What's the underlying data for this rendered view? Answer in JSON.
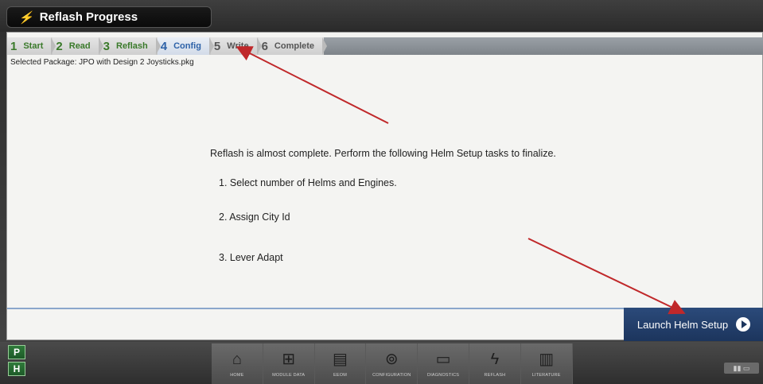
{
  "window": {
    "title": "Reflash Progress",
    "title_icon": "lightning-bolt-icon"
  },
  "steps": [
    {
      "num": "1",
      "label": "Start",
      "state": "done"
    },
    {
      "num": "2",
      "label": "Read",
      "state": "done"
    },
    {
      "num": "3",
      "label": "Reflash",
      "state": "done"
    },
    {
      "num": "4",
      "label": "Config",
      "state": "active"
    },
    {
      "num": "5",
      "label": "Write",
      "state": "todo"
    },
    {
      "num": "6",
      "label": "Complete",
      "state": "todo"
    }
  ],
  "selected_package": "Selected Package: JPO with Design 2 Joysticks.pkg",
  "message": "Reflash is almost complete. Perform the following Helm Setup tasks to finalize.",
  "tasks": [
    "1. Select number of Helms and Engines.",
    "2. Assign City Id",
    "3. Lever Adapt"
  ],
  "launch_button": {
    "label": "Launch Helm Setup"
  },
  "side_buttons": [
    "P",
    "H"
  ],
  "nav": [
    {
      "label": "HOME",
      "icon": "house-icon"
    },
    {
      "label": "MODULE DATA",
      "icon": "module-data-icon"
    },
    {
      "label": "EEOM",
      "icon": "eeom-icon"
    },
    {
      "label": "CONFIGURATION",
      "icon": "configuration-icon"
    },
    {
      "label": "DIAGNOSTICS",
      "icon": "diagnostics-icon"
    },
    {
      "label": "REFLASH",
      "icon": "lightning-bolt-icon"
    },
    {
      "label": "LITERATURE",
      "icon": "book-icon"
    }
  ],
  "colors": {
    "done": "#3a7a2a",
    "active": "#2e62a8",
    "button": "#1c355d",
    "annotation_arrow": "#c0282a"
  }
}
